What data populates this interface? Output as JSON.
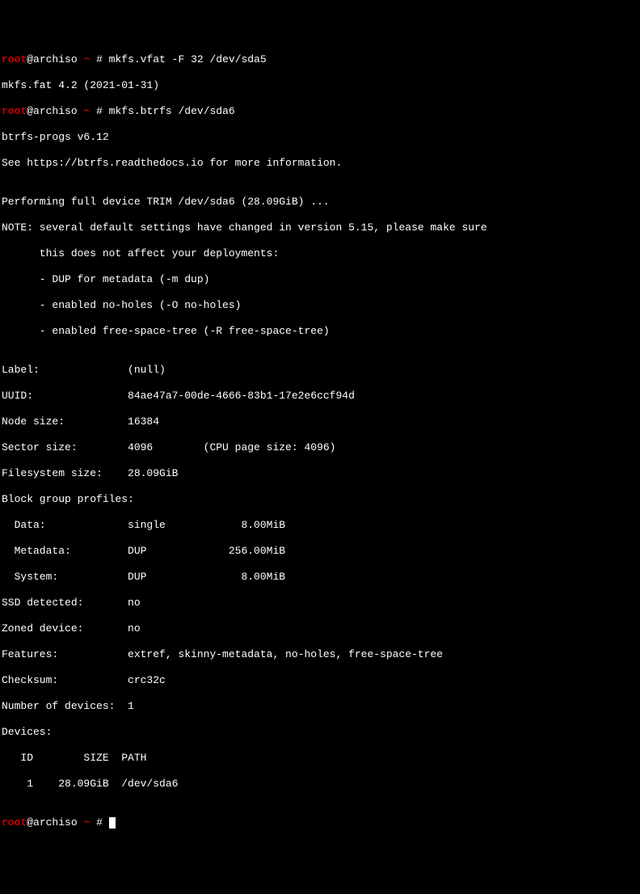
{
  "prompt1": {
    "user": "root",
    "at": "@",
    "host": "archiso ",
    "cwd": "~",
    "symbol": " # ",
    "command": "mkfs.vfat -F 32 /dev/sda5"
  },
  "vfat_output": "mkfs.fat 4.2 (2021-01-31)",
  "prompt2": {
    "user": "root",
    "at": "@",
    "host": "archiso ",
    "cwd": "~",
    "symbol": " # ",
    "command": "mkfs.btrfs /dev/sda6"
  },
  "btrfs": {
    "version": "btrfs-progs v6.12",
    "see": "See https://btrfs.readthedocs.io for more information.",
    "blank1": "",
    "trim": "Performing full device TRIM /dev/sda6 (28.09GiB) ...",
    "note1": "NOTE: several default settings have changed in version 5.15, please make sure",
    "note2": "      this does not affect your deployments:",
    "note3": "      - DUP for metadata (-m dup)",
    "note4": "      - enabled no-holes (-O no-holes)",
    "note5": "      - enabled free-space-tree (-R free-space-tree)",
    "blank2": "",
    "label": "Label:              (null)",
    "uuid": "UUID:               84ae47a7-00de-4666-83b1-17e2e6ccf94d",
    "nodesize": "Node size:          16384",
    "sectorsize": "Sector size:        4096        (CPU page size: 4096)",
    "fssize": "Filesystem size:    28.09GiB",
    "blockgroup": "Block group profiles:",
    "data": "  Data:             single            8.00MiB",
    "metadata": "  Metadata:         DUP             256.00MiB",
    "system": "  System:           DUP               8.00MiB",
    "ssd": "SSD detected:       no",
    "zoned": "Zoned device:       no",
    "features": "Features:           extref, skinny-metadata, no-holes, free-space-tree",
    "checksum": "Checksum:           crc32c",
    "numdevices": "Number of devices:  1",
    "devices": "Devices:",
    "devheader": "   ID        SIZE  PATH",
    "devrow": "    1    28.09GiB  /dev/sda6",
    "blank3": ""
  },
  "prompt3": {
    "user": "root",
    "at": "@",
    "host": "archiso ",
    "cwd": "~",
    "symbol": " # "
  }
}
